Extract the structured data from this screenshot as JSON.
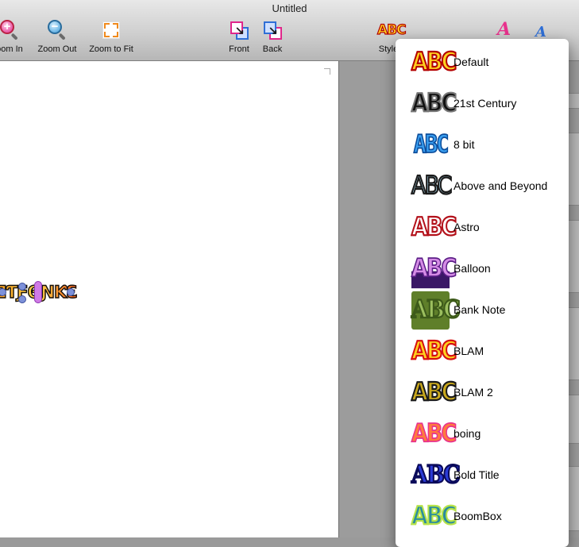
{
  "window": {
    "title": "Untitled"
  },
  "toolbar": {
    "zoom_in": "oom In",
    "zoom_out": "Zoom Out",
    "zoom_fit": "Zoom to Fit",
    "front": "Front",
    "back": "Back",
    "styles": "Style"
  },
  "style_menu": {
    "items": [
      {
        "name": "Default",
        "icon": "style-default-icon"
      },
      {
        "name": "21st Century",
        "icon": "style-21st-century-icon"
      },
      {
        "name": "8 bit",
        "icon": "style-8-bit-icon"
      },
      {
        "name": "Above and Beyond",
        "icon": "style-above-and-beyond-icon"
      },
      {
        "name": "Astro",
        "icon": "style-astro-icon"
      },
      {
        "name": "Balloon",
        "icon": "style-balloon-icon"
      },
      {
        "name": "Bank Note",
        "icon": "style-bank-note-icon"
      },
      {
        "name": "BLAM",
        "icon": "style-blam-icon"
      },
      {
        "name": "BLAM 2",
        "icon": "style-blam-2-icon"
      },
      {
        "name": "boing",
        "icon": "style-boing-icon"
      },
      {
        "name": "Bold Title",
        "icon": "style-bold-title-icon"
      },
      {
        "name": "BoomBox",
        "icon": "style-boombox-icon"
      }
    ],
    "swatch_text": "ABC"
  },
  "colors": {
    "menu_bg": "#ffffff",
    "canvas_bg": "#9c9c9c",
    "handle": "#7d91d9"
  }
}
